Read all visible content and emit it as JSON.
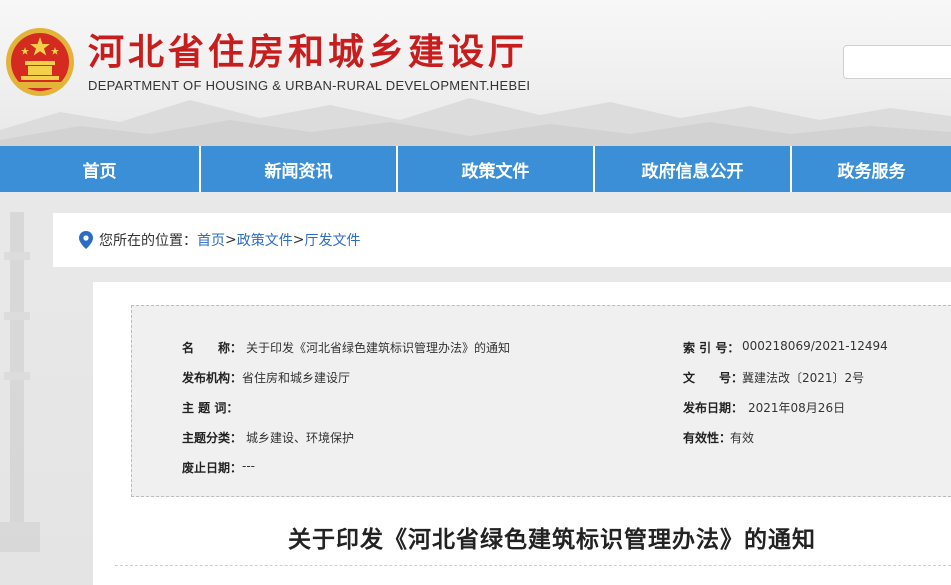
{
  "header": {
    "site_title": "河北省住房和城乡建设厅",
    "site_subtitle": "DEPARTMENT OF HOUSING & URBAN-RURAL DEVELOPMENT.HEBEI",
    "search_value": ""
  },
  "nav": {
    "items": [
      "首页",
      "新闻资讯",
      "政策文件",
      "政府信息公开",
      "政务服务"
    ]
  },
  "breadcrumb": {
    "prefix": "您所在的位置：",
    "items": [
      "首页",
      "政策文件",
      "厅发文件"
    ],
    "separator": ">"
  },
  "meta": {
    "name_label": "名　　称：",
    "name_value": "关于印发《河北省绿色建筑标识管理办法》的通知",
    "index_label": "索 引 号：",
    "index_value": "000218069/2021-12494",
    "org_label": "发布机构：",
    "org_value": "省住房和城乡建设厅",
    "docno_label": "文　　号：",
    "docno_value": "冀建法改〔2021〕2号",
    "subject_label": "主 题 词：",
    "subject_value": "",
    "date_label": "发布日期：",
    "date_value": "2021年08月26日",
    "category_label": "主题分类：",
    "category_value": "城乡建设、环境保护",
    "validity_label": "有效性：",
    "validity_value": "有效",
    "expiry_label": "废止日期：",
    "expiry_value": "---"
  },
  "article": {
    "title": "关于印发《河北省绿色建筑标识管理办法》的通知"
  },
  "colors": {
    "brand_red": "#c81d1d",
    "nav_blue": "#3a8fd6",
    "link_blue": "#2b6cc4"
  },
  "icons": {
    "emblem": "national-emblem-icon",
    "location": "location-pin-icon"
  }
}
